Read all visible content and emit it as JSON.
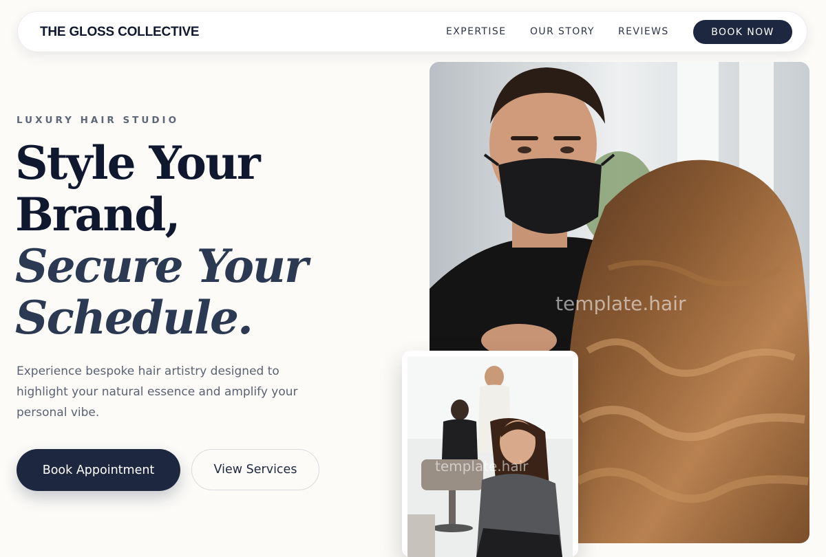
{
  "nav": {
    "brand": "THE GLOSS COLLECTIVE",
    "links": [
      "EXPERTISE",
      "OUR STORY",
      "REVIEWS"
    ],
    "cta": "BOOK NOW"
  },
  "hero": {
    "eyebrow": "LUXURY HAIR STUDIO",
    "headline_line1": "Style Your",
    "headline_line2": "Brand,",
    "headline_italic1": "Secure Your",
    "headline_italic2": "Schedule.",
    "description": "Experience bespoke hair artistry designed to highlight your natural essence and amplify your personal vibe.",
    "primary_cta": "Book Appointment",
    "secondary_cta": "View Services"
  },
  "images": {
    "main_watermark": "template.hair",
    "small_watermark": "template.hair"
  },
  "colors": {
    "navy": "#1d2740",
    "background": "#fcfbf8",
    "muted_text": "#5a6272"
  }
}
